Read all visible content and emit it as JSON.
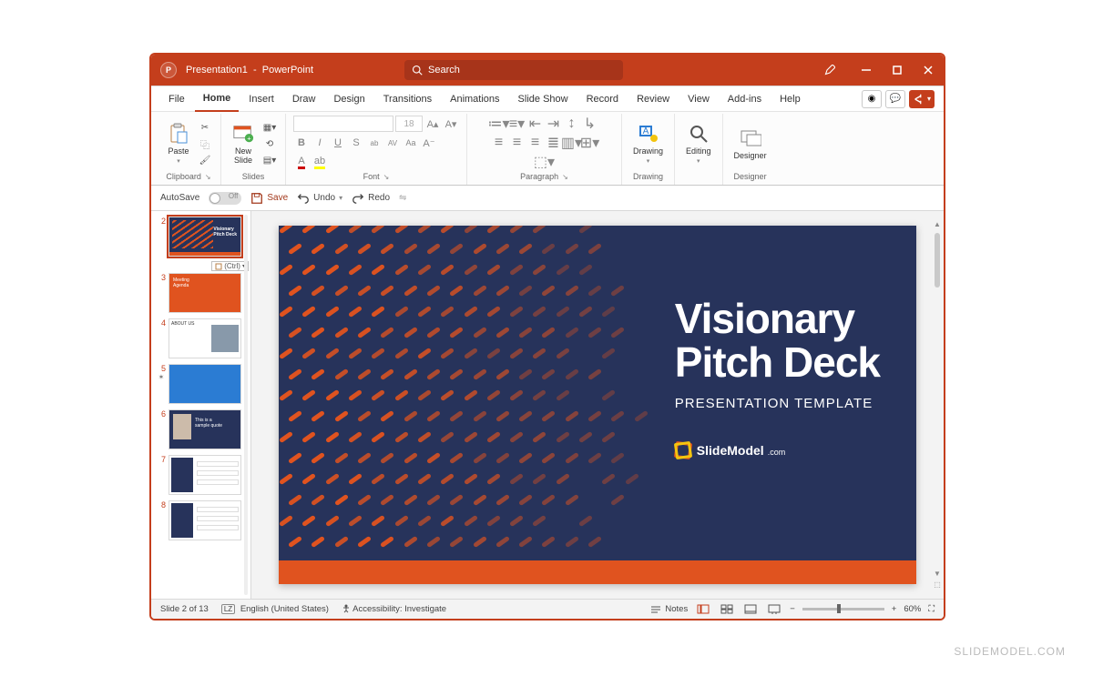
{
  "title_bar": {
    "app_badge": "P",
    "document_name": "Presentation1",
    "app_name": "PowerPoint",
    "search_placeholder": "Search"
  },
  "tabs": [
    "File",
    "Home",
    "Insert",
    "Draw",
    "Design",
    "Transitions",
    "Animations",
    "Slide Show",
    "Record",
    "Review",
    "View",
    "Add-ins",
    "Help"
  ],
  "active_tab": "Home",
  "ribbon": {
    "clipboard": {
      "paste": "Paste",
      "label": "Clipboard"
    },
    "slides": {
      "new_slide": "New\nSlide",
      "label": "Slides"
    },
    "font": {
      "size": "18",
      "label": "Font",
      "buttons": [
        "B",
        "I",
        "U",
        "S",
        "ab",
        "AV",
        "Aa",
        "A"
      ]
    },
    "paragraph": {
      "label": "Paragraph"
    },
    "drawing": {
      "label": "Drawing",
      "btn": "Drawing"
    },
    "editing": {
      "label": "Editing",
      "btn": "Editing"
    },
    "designer": {
      "label": "Designer",
      "btn": "Designer"
    }
  },
  "qat": {
    "autosave": "AutoSave",
    "autosave_state": "Off",
    "save": "Save",
    "undo": "Undo",
    "redo": "Redo"
  },
  "thumbnails": {
    "ctrl_label": "(Ctrl)",
    "items": [
      {
        "num": "2"
      },
      {
        "num": "3"
      },
      {
        "num": "4"
      },
      {
        "num": "5"
      },
      {
        "num": "6"
      },
      {
        "num": "7"
      },
      {
        "num": "8"
      }
    ],
    "selected_index": 0,
    "star_index": 3
  },
  "slide": {
    "title_line1": "Visionary",
    "title_line2": "Pitch Deck",
    "subtitle": "PRESENTATION TEMPLATE",
    "brand": "SlideModel",
    "brand_suffix": ".com"
  },
  "status": {
    "slide_counter": "Slide 2 of 13",
    "language": "English (United States)",
    "accessibility": "Accessibility: Investigate",
    "notes": "Notes",
    "zoom": "60%"
  },
  "watermark": "SLIDEMODEL.COM"
}
